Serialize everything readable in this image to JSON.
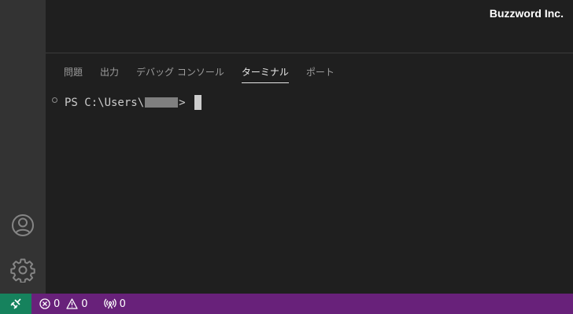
{
  "watermark": "Buzzword Inc.",
  "activity_bar": {
    "accounts_icon": "account-icon",
    "settings_icon": "gear-icon"
  },
  "panel": {
    "tabs": [
      {
        "label": "問題",
        "active": false
      },
      {
        "label": "出力",
        "active": false
      },
      {
        "label": "デバッグ コンソール",
        "active": false
      },
      {
        "label": "ターミナル",
        "active": true
      },
      {
        "label": "ポート",
        "active": false
      }
    ]
  },
  "terminal": {
    "prompt_prefix": "PS C:\\Users\\",
    "prompt_suffix": ">"
  },
  "status_bar": {
    "errors": "0",
    "warnings": "0",
    "ports": "0",
    "colors": {
      "background": "#68217a",
      "remote": "#16825d"
    }
  }
}
